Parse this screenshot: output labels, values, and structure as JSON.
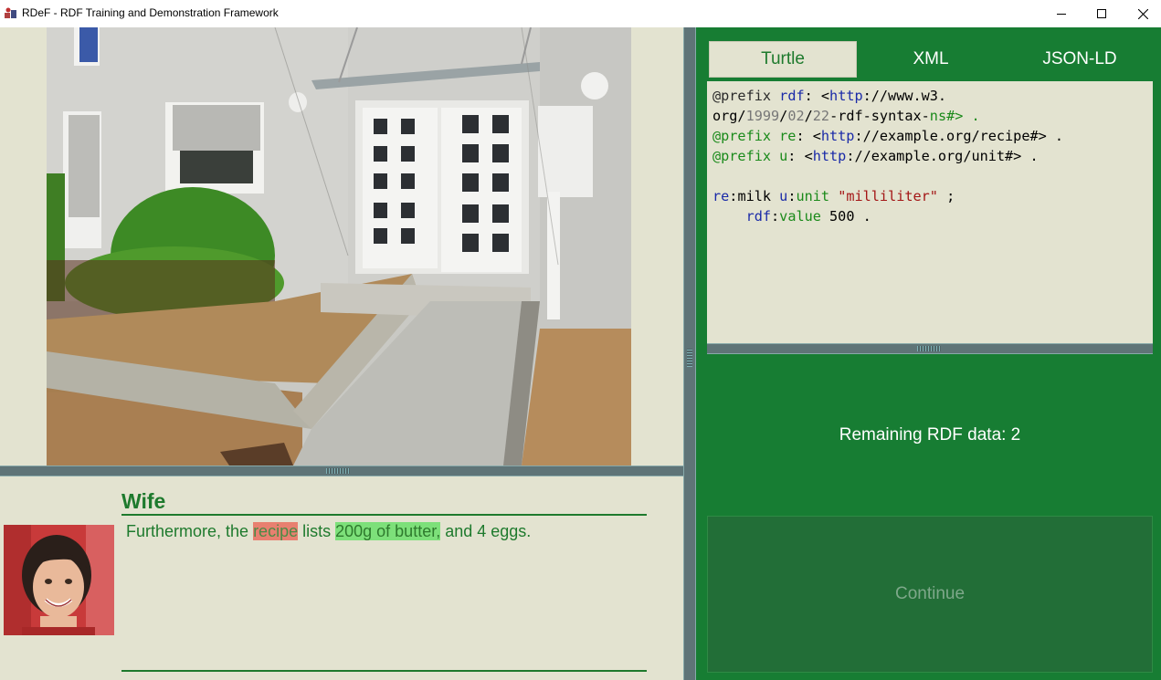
{
  "window": {
    "title": "RDeF - RDF Training and Demonstration Framework",
    "icon": "rdef-app-icon",
    "controls": [
      "minimize-icon",
      "maximize-icon",
      "close-icon"
    ]
  },
  "scene": {
    "image": "house-entrance-photo"
  },
  "dialog": {
    "speaker": "Wife",
    "avatar": "wife-avatar-photo",
    "text_before": "Furthermore, the ",
    "highlight_red": "recipe",
    "text_middle": " lists ",
    "highlight_green": "200g of butter,",
    "text_after": " and 4 eggs."
  },
  "tabs": [
    {
      "label": "Turtle",
      "active": true
    },
    {
      "label": "XML",
      "active": false
    },
    {
      "label": "JSON-LD",
      "active": false
    }
  ],
  "code": {
    "lines": [
      "@prefix rdf: <http://www.w3.",
      "org/1999/02/22-rdf-syntax-ns#> .",
      "@prefix re: <http://example.org/recipe#> .",
      "@prefix u: <http://example.org/unit#> .",
      "",
      "re:milk u:unit \"milliliter\" ;",
      "    rdf:value 500 ."
    ]
  },
  "status": {
    "remaining": "Remaining RDF data: 2"
  },
  "buttons": {
    "continue": "Continue"
  },
  "colors": {
    "panel_bg": "#e3e3d0",
    "green_panel": "#177d33",
    "accent_green": "#1e7a2d",
    "splitter": "#5f7477",
    "highlight_red": "#e88070",
    "highlight_green": "#7de07a"
  }
}
